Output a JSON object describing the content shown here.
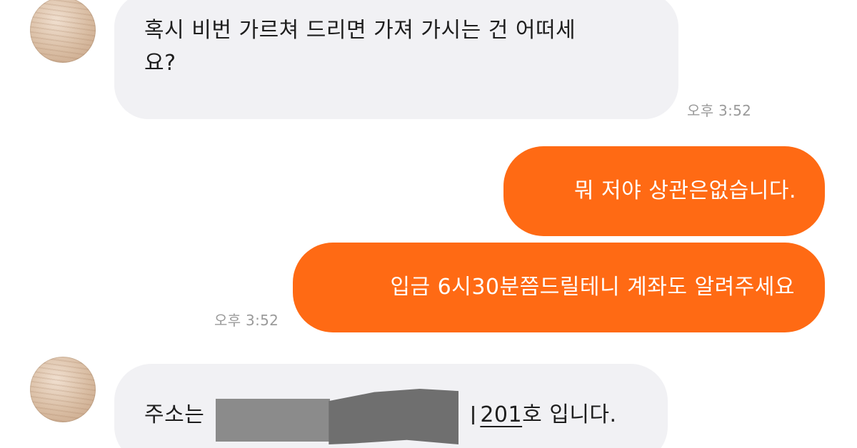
{
  "messages": [
    {
      "direction": "incoming",
      "text_line1": "혹시 비번 가르쳐 드리면 가져 가시는 건 어떠세",
      "text_line2": "요?",
      "time": "오후 3:52"
    },
    {
      "direction": "outgoing",
      "text": "뭐 저야 상관은없습니다."
    },
    {
      "direction": "outgoing",
      "text": "입금 6시30분쯤드릴테니 계좌도 알려주세요",
      "time": "오후 3:52"
    },
    {
      "direction": "incoming",
      "text_prefix": "주소는",
      "text_number": "201",
      "text_suffix": "호 입니다."
    }
  ],
  "colors": {
    "outgoing_bubble": "#ff6a14",
    "incoming_bubble": "#f1f1f4",
    "timestamp": "#9a9a9a"
  }
}
